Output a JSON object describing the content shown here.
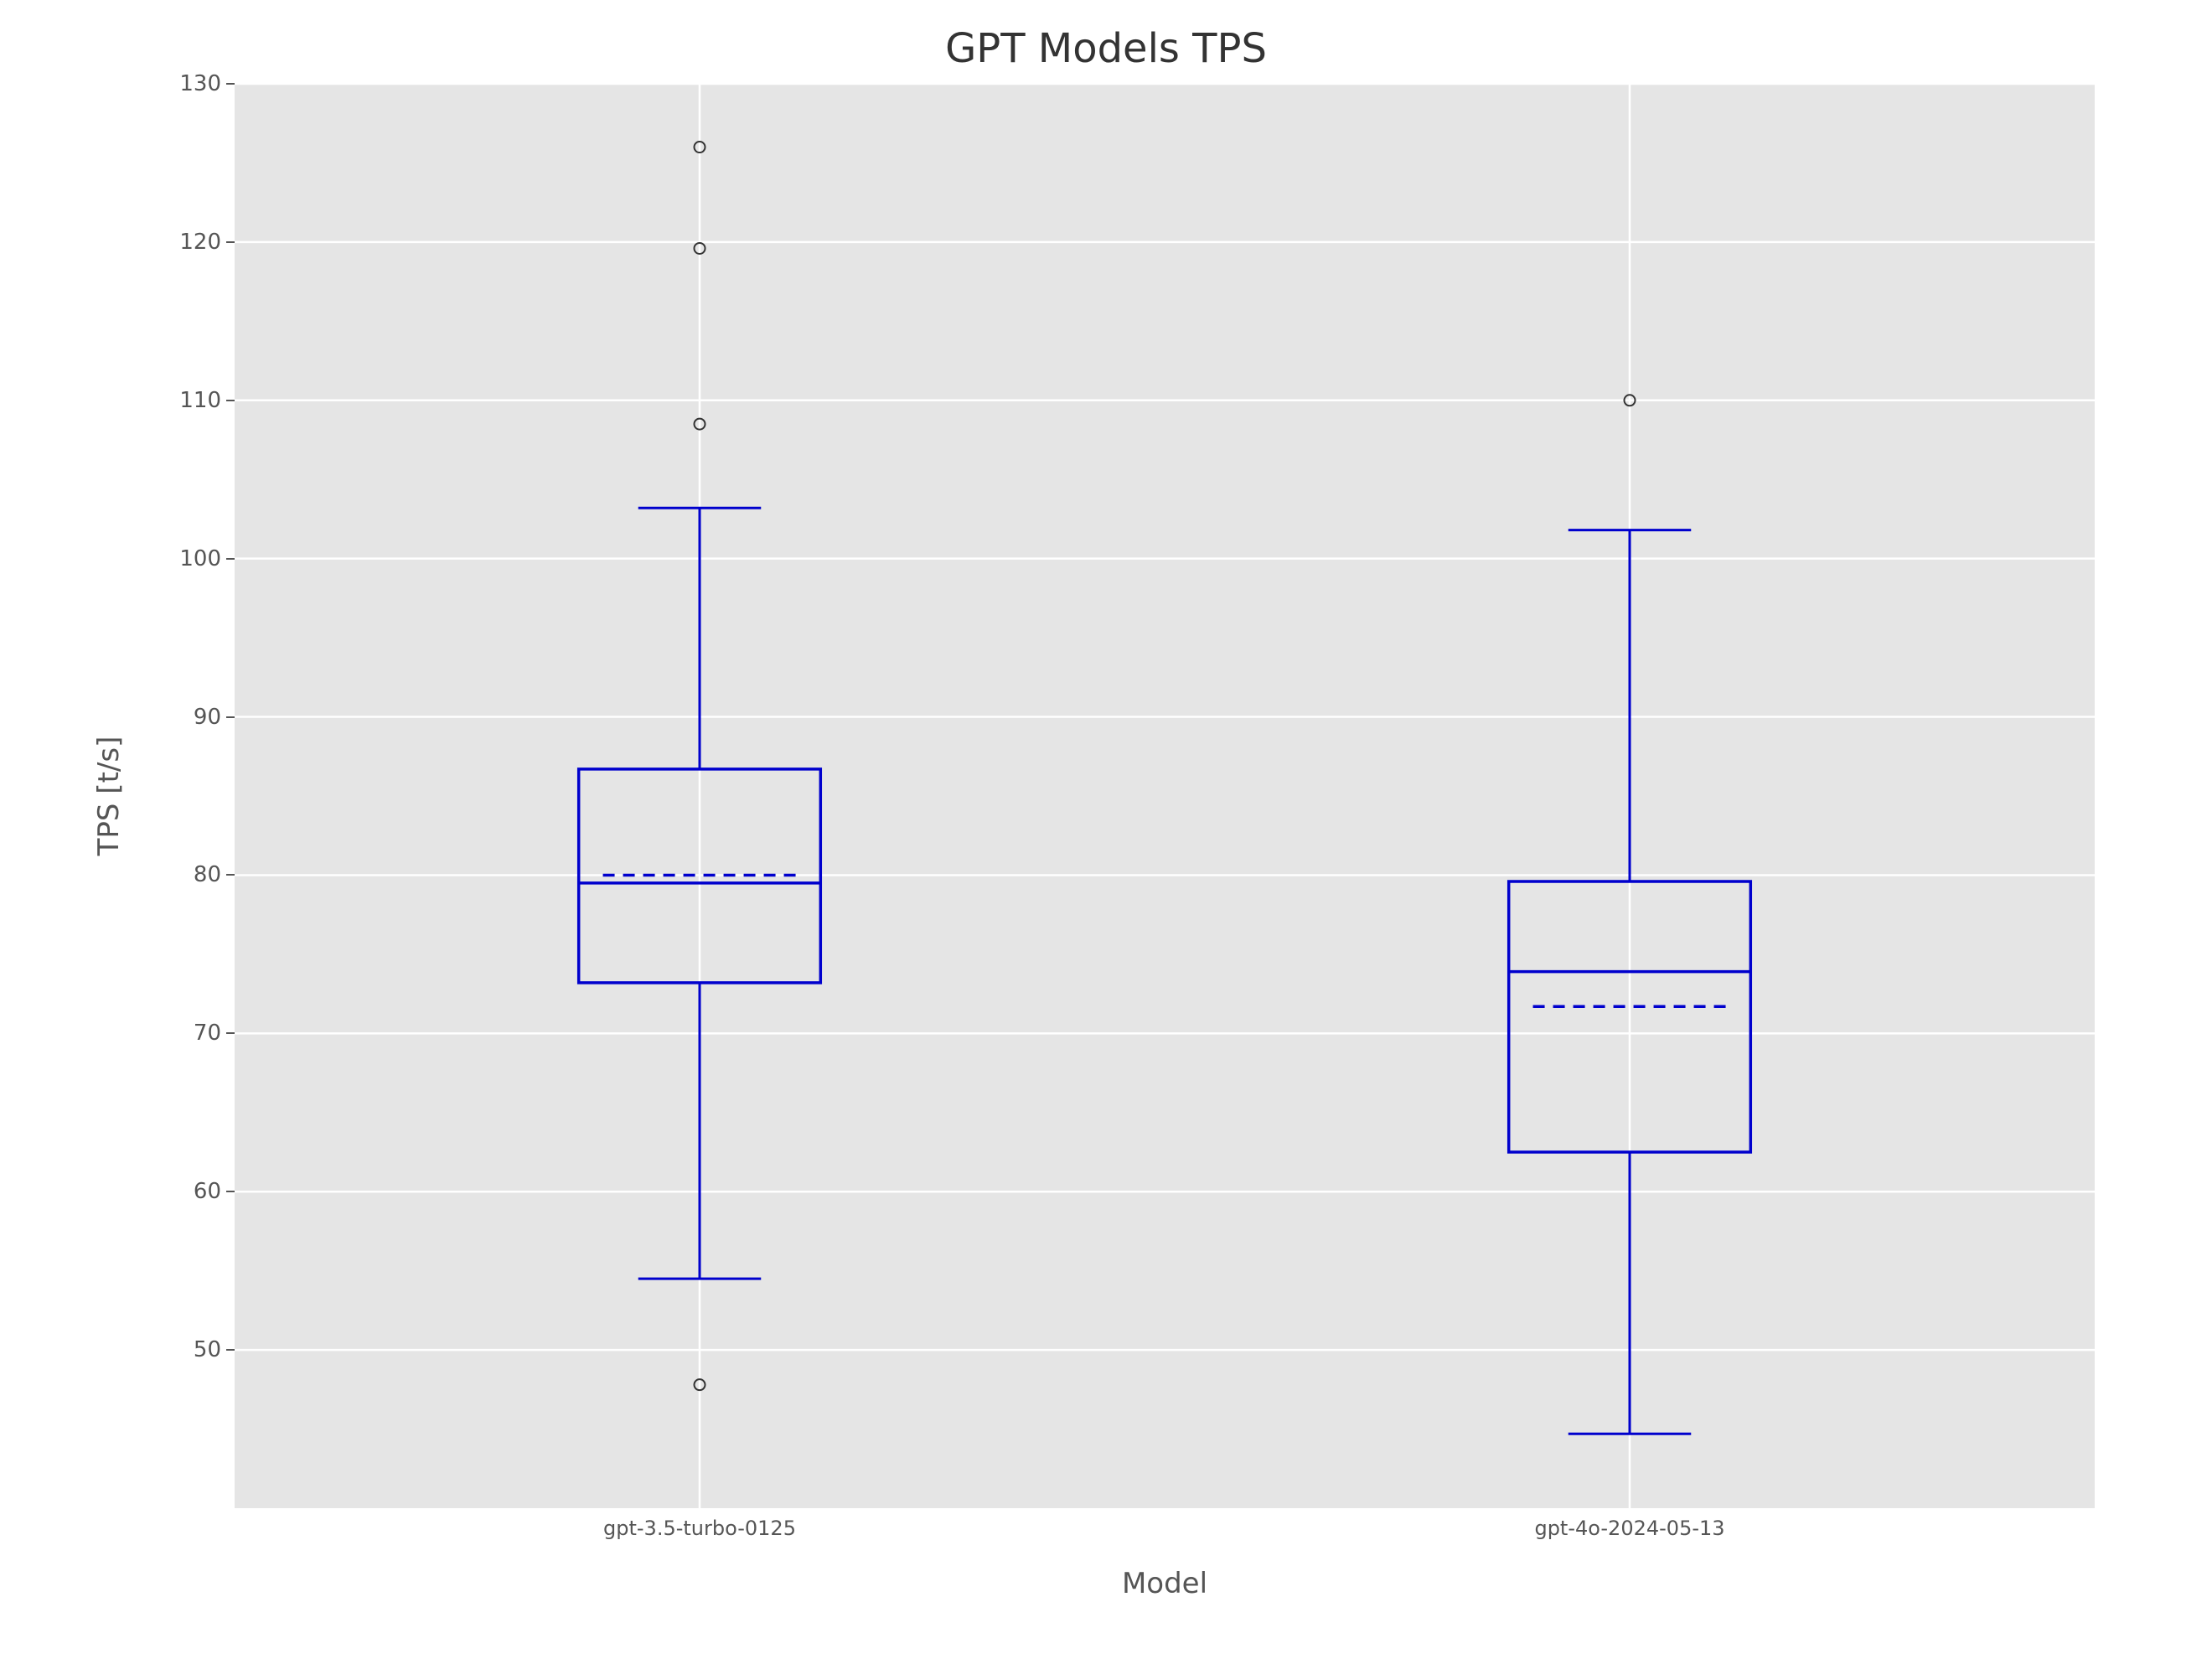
{
  "chart_data": {
    "type": "boxplot",
    "title": "GPT Models TPS",
    "xlabel": "Model",
    "ylabel": "TPS [t/s]",
    "ylim": [
      40,
      130
    ],
    "y_ticks": [
      50,
      60,
      70,
      80,
      90,
      100,
      110,
      120,
      130
    ],
    "categories": [
      "gpt-3.5-turbo-0125",
      "gpt-4o-2024-05-13"
    ],
    "series": [
      {
        "name": "gpt-3.5-turbo-0125",
        "q1": 73.2,
        "median": 79.5,
        "mean": 80.0,
        "q3": 86.7,
        "whisker_low": 54.5,
        "whisker_high": 103.2,
        "outliers": [
          47.8,
          108.5,
          119.6,
          126.0
        ]
      },
      {
        "name": "gpt-4o-2024-05-13",
        "q1": 62.5,
        "median": 73.9,
        "mean": 71.7,
        "q3": 79.6,
        "whisker_low": 44.7,
        "whisker_high": 101.8,
        "outliers": [
          110.0
        ]
      }
    ],
    "box_color": "#0000CD",
    "grid_color": "#FFFFFF",
    "plot_bg": "#E5E5E5"
  }
}
